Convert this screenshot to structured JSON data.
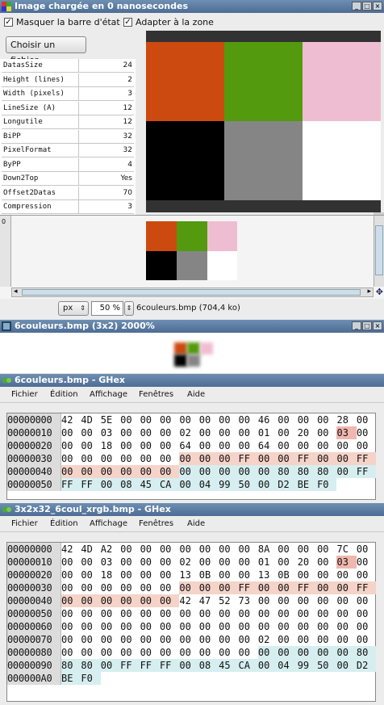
{
  "viewer": {
    "title": "Image chargée en 0 nanosecondes",
    "cb_statusbar": "Masquer la barre d'état",
    "cb_fit": "Adapter à la zone",
    "choose_btn": "Choisir un fichier...",
    "props": [
      {
        "k": "DatasSize",
        "v": "24"
      },
      {
        "k": "Height (lines)",
        "v": "2"
      },
      {
        "k": "Width (pixels)",
        "v": "3"
      },
      {
        "k": "LineSize (A)",
        "v": "12"
      },
      {
        "k": "Longutile",
        "v": "12"
      },
      {
        "k": "BiPP",
        "v": "32"
      },
      {
        "k": "PixelFormat",
        "v": "32"
      },
      {
        "k": "ByPP",
        "v": "4"
      },
      {
        "k": "Down2Top",
        "v": "Yes"
      },
      {
        "k": "Offset2Datas",
        "v": "70"
      },
      {
        "k": "Compression",
        "v": "3"
      }
    ],
    "colors": [
      "#cc4a10",
      "#539a0e",
      "#efbdd2",
      "#000000",
      "#858585",
      "#ffffff"
    ],
    "ruler_zero": "0",
    "unit": "px",
    "zoom": "50 %",
    "file_status": "6couleurs.bmp (704,4 ko)"
  },
  "zoomwin": {
    "title": "6couleurs.bmp (3x2) 2000%"
  },
  "ghex1": {
    "title": "6couleurs.bmp - GHex",
    "menu": [
      "Fichier",
      "Édition",
      "Affichage",
      "Fenêtres",
      "Aide"
    ],
    "rows": [
      {
        "off": "00000000",
        "bytes": [
          "42",
          "4D",
          "5E",
          "00",
          "00",
          "00",
          "00",
          "00",
          "00",
          "00",
          "46",
          "00",
          "00",
          "00",
          "28",
          "00"
        ]
      },
      {
        "off": "00000010",
        "bytes": [
          "00",
          "00",
          "03",
          "00",
          "00",
          "00",
          "02",
          "00",
          "00",
          "00",
          "01",
          "00",
          "20",
          "00",
          "03",
          "00"
        ]
      },
      {
        "off": "00000020",
        "bytes": [
          "00",
          "00",
          "18",
          "00",
          "00",
          "00",
          "64",
          "00",
          "00",
          "00",
          "64",
          "00",
          "00",
          "00",
          "00",
          "00"
        ]
      },
      {
        "off": "00000030",
        "bytes": [
          "00",
          "00",
          "00",
          "00",
          "00",
          "00",
          "00",
          "00",
          "00",
          "FF",
          "00",
          "00",
          "FF",
          "00",
          "00",
          "FF"
        ]
      },
      {
        "off": "00000040",
        "bytes": [
          "00",
          "00",
          "00",
          "00",
          "00",
          "00",
          "00",
          "00",
          "00",
          "00",
          "00",
          "80",
          "80",
          "80",
          "00",
          "FF"
        ]
      },
      {
        "off": "00000050",
        "bytes": [
          "FF",
          "FF",
          "00",
          "08",
          "45",
          "CA",
          "00",
          "04",
          "99",
          "50",
          "00",
          "D2",
          "BE",
          "F0"
        ]
      }
    ]
  },
  "ghex2": {
    "title": "3x2x32_6coul_xrgb.bmp - GHex",
    "menu": [
      "Fichier",
      "Édition",
      "Affichage",
      "Fenêtres",
      "Aide"
    ],
    "rows": [
      {
        "off": "00000000",
        "bytes": [
          "42",
          "4D",
          "A2",
          "00",
          "00",
          "00",
          "00",
          "00",
          "00",
          "00",
          "8A",
          "00",
          "00",
          "00",
          "7C",
          "00"
        ]
      },
      {
        "off": "00000010",
        "bytes": [
          "00",
          "00",
          "03",
          "00",
          "00",
          "00",
          "02",
          "00",
          "00",
          "00",
          "01",
          "00",
          "20",
          "00",
          "03",
          "00"
        ]
      },
      {
        "off": "00000020",
        "bytes": [
          "00",
          "00",
          "18",
          "00",
          "00",
          "00",
          "13",
          "0B",
          "00",
          "00",
          "13",
          "0B",
          "00",
          "00",
          "00",
          "00"
        ]
      },
      {
        "off": "00000030",
        "bytes": [
          "00",
          "00",
          "00",
          "00",
          "00",
          "00",
          "00",
          "00",
          "00",
          "FF",
          "00",
          "00",
          "FF",
          "00",
          "00",
          "FF"
        ]
      },
      {
        "off": "00000040",
        "bytes": [
          "00",
          "00",
          "00",
          "00",
          "00",
          "00",
          "42",
          "47",
          "52",
          "73",
          "00",
          "00",
          "00",
          "00",
          "00",
          "00"
        ]
      },
      {
        "off": "00000050",
        "bytes": [
          "00",
          "00",
          "00",
          "00",
          "00",
          "00",
          "00",
          "00",
          "00",
          "00",
          "00",
          "00",
          "00",
          "00",
          "00",
          "00"
        ]
      },
      {
        "off": "00000060",
        "bytes": [
          "00",
          "00",
          "00",
          "00",
          "00",
          "00",
          "00",
          "00",
          "00",
          "00",
          "00",
          "00",
          "00",
          "00",
          "00",
          "00"
        ]
      },
      {
        "off": "00000070",
        "bytes": [
          "00",
          "00",
          "00",
          "00",
          "00",
          "00",
          "00",
          "00",
          "00",
          "00",
          "02",
          "00",
          "00",
          "00",
          "00",
          "00"
        ]
      },
      {
        "off": "00000080",
        "bytes": [
          "00",
          "00",
          "00",
          "00",
          "00",
          "00",
          "00",
          "00",
          "00",
          "00",
          "00",
          "00",
          "00",
          "00",
          "00",
          "80"
        ]
      },
      {
        "off": "00000090",
        "bytes": [
          "80",
          "80",
          "00",
          "FF",
          "FF",
          "FF",
          "00",
          "08",
          "45",
          "CA",
          "00",
          "04",
          "99",
          "50",
          "00",
          "D2"
        ]
      },
      {
        "off": "000000A0",
        "bytes": [
          "BE",
          "F0"
        ]
      }
    ]
  }
}
